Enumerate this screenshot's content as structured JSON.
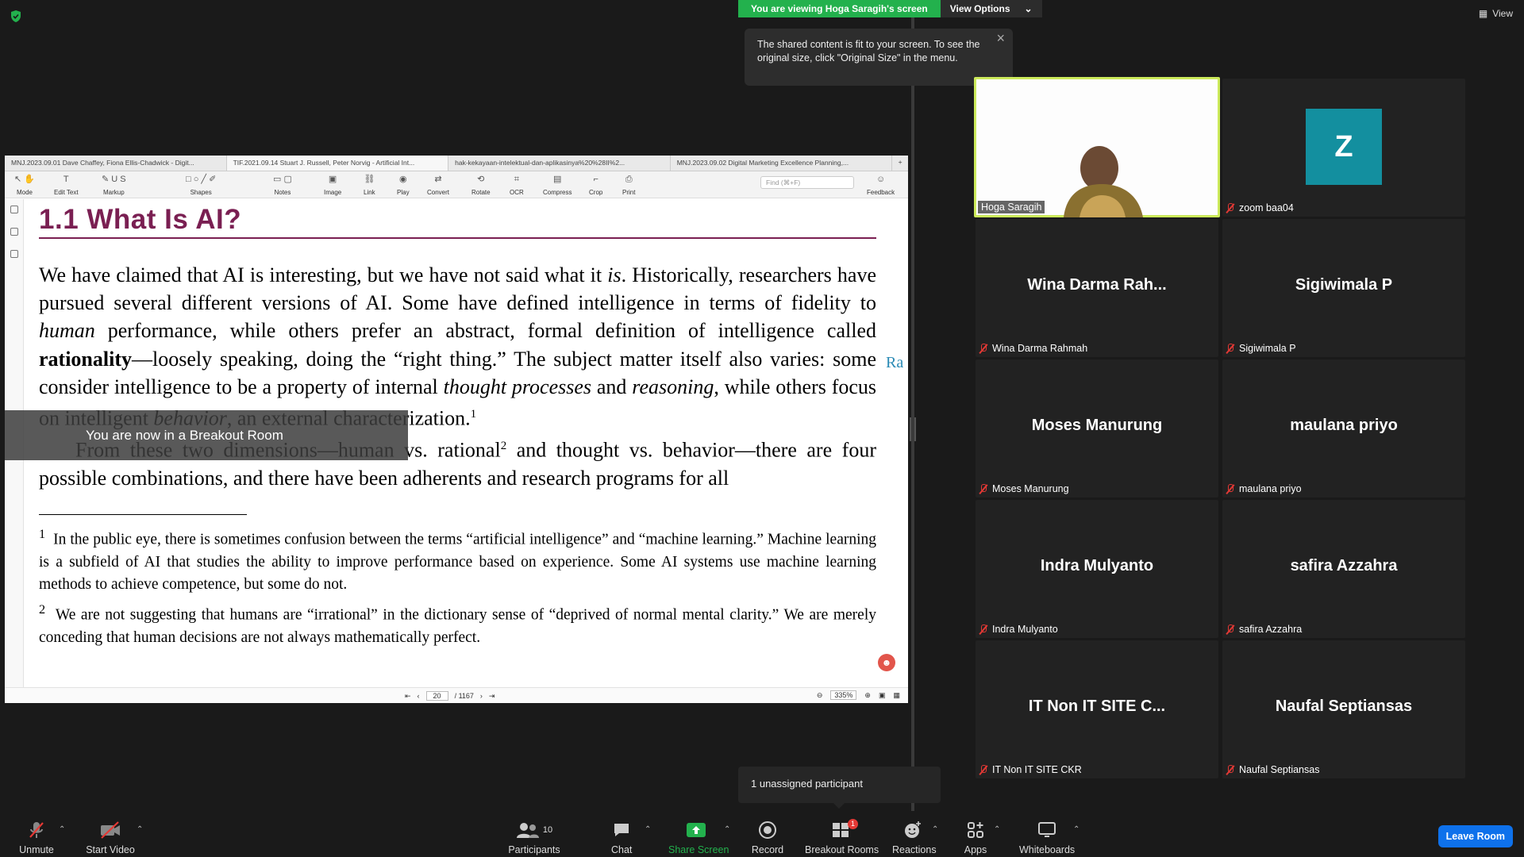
{
  "top": {
    "viewing_banner": "You are viewing Hoga Saragih's screen",
    "view_options": "View Options",
    "view_label": "View",
    "tooltip": "The shared content is fit to your screen. To see the original size, click \"Original Size\" in the menu."
  },
  "pdf": {
    "tabs": [
      "MNJ.2023.09.01 Dave Chaffey, Fiona Ellis-Chadwick - Digit...",
      "TIF.2021.09.14 Stuart J. Russell, Peter Norvig - Artificial Int...",
      "hak-kekayaan-intelektual-dan-aplikasinya%20%28II%2...",
      "MNJ.2023.09.02 Digital Marketing Excellence Planning,..."
    ],
    "toolbar": [
      "Mode",
      "Edit Text",
      "Markup",
      "Shapes",
      "Notes",
      "Image",
      "Link",
      "Play",
      "Convert",
      "Rotate",
      "OCR",
      "Compress",
      "Crop",
      "Print",
      "Feedback"
    ],
    "find_placeholder": "Find (⌘+F)",
    "heading": "1.1  What Is AI?",
    "page_current": "20",
    "page_total": "/ 1167",
    "zoom": "335%"
  },
  "doc": {
    "p1_a": "We have claimed that AI is interesting, but we have not said what it ",
    "p1_is": "is",
    "p1_b": ".  Historically, researchers have pursued several different versions of AI. Some have defined intelligence in terms of fidelity to ",
    "p1_human": "human",
    "p1_c": " performance, while others prefer an abstract, formal definition of intelligence called ",
    "p1_rationality": "rationality",
    "p1_d": "—loosely speaking, doing the “right thing.” The subject matter itself also varies:  some consider intelligence to be a property of internal ",
    "p1_thought": "thought processes",
    "p1_e": " and ",
    "p1_reasoning": "reasoning",
    "p1_f": ", while others focus on intelligent ",
    "p1_behavior": "behavior",
    "p1_g": ", an external characterization.",
    "sup1": "1",
    "p2_a": "From these two dimensions—human vs. rational",
    "sup2": "2",
    "p2_b": " and thought vs. behavior—there are four possible combinations, and there have been adherents and research programs for all",
    "fn1_num": "1",
    "fn1": "In the public eye, there is sometimes confusion between the terms “artificial intelligence” and “machine learning.” Machine learning is a subfield of AI that studies the ability to improve performance based on experience. Some AI systems use machine learning methods to achieve competence, but some do not.",
    "fn2_num": "2",
    "fn2": "We are not suggesting that humans are “irrational” in the dictionary sense of “deprived of normal mental clarity.” We are merely conceding that human decisions are not always mathematically perfect.",
    "side_text": "Ra"
  },
  "breakout_note": "You are now in a Breakout Room",
  "gallery": {
    "active": {
      "label": "Hoga Saragih"
    },
    "z_avatar": {
      "letter": "Z",
      "label": "zoom baa04"
    },
    "tiles": [
      {
        "name": "Wina Darma Rah...",
        "label": "Wina Darma Rahmah"
      },
      {
        "name": "Sigiwimala P",
        "label": "Sigiwimala P"
      },
      {
        "name": "Moses Manurung",
        "label": "Moses Manurung"
      },
      {
        "name": "maulana priyo",
        "label": "maulana priyo"
      },
      {
        "name": "Indra Mulyanto",
        "label": "Indra Mulyanto"
      },
      {
        "name": "safira Azzahra",
        "label": "safira Azzahra"
      },
      {
        "name": "IT Non IT SITE C...",
        "label": "IT Non IT SITE CKR"
      },
      {
        "name": "Naufal Septiansas",
        "label": "Naufal Septiansas"
      }
    ]
  },
  "unassigned": "1 unassigned participant",
  "bottom": {
    "unmute": "Unmute",
    "start_video": "Start Video",
    "participants": "Participants",
    "participants_count": "10",
    "chat": "Chat",
    "share_screen": "Share Screen",
    "record": "Record",
    "breakout_rooms": "Breakout Rooms",
    "breakout_badge": "1",
    "reactions": "Reactions",
    "apps": "Apps",
    "whiteboards": "Whiteboards",
    "leave_room": "Leave Room"
  },
  "colors": {
    "banner_green": "#23b14d",
    "heading_maroon": "#7a1f52",
    "active_border": "#cbe95a",
    "leave_blue": "#0e71eb",
    "muted_red": "#e53935"
  }
}
